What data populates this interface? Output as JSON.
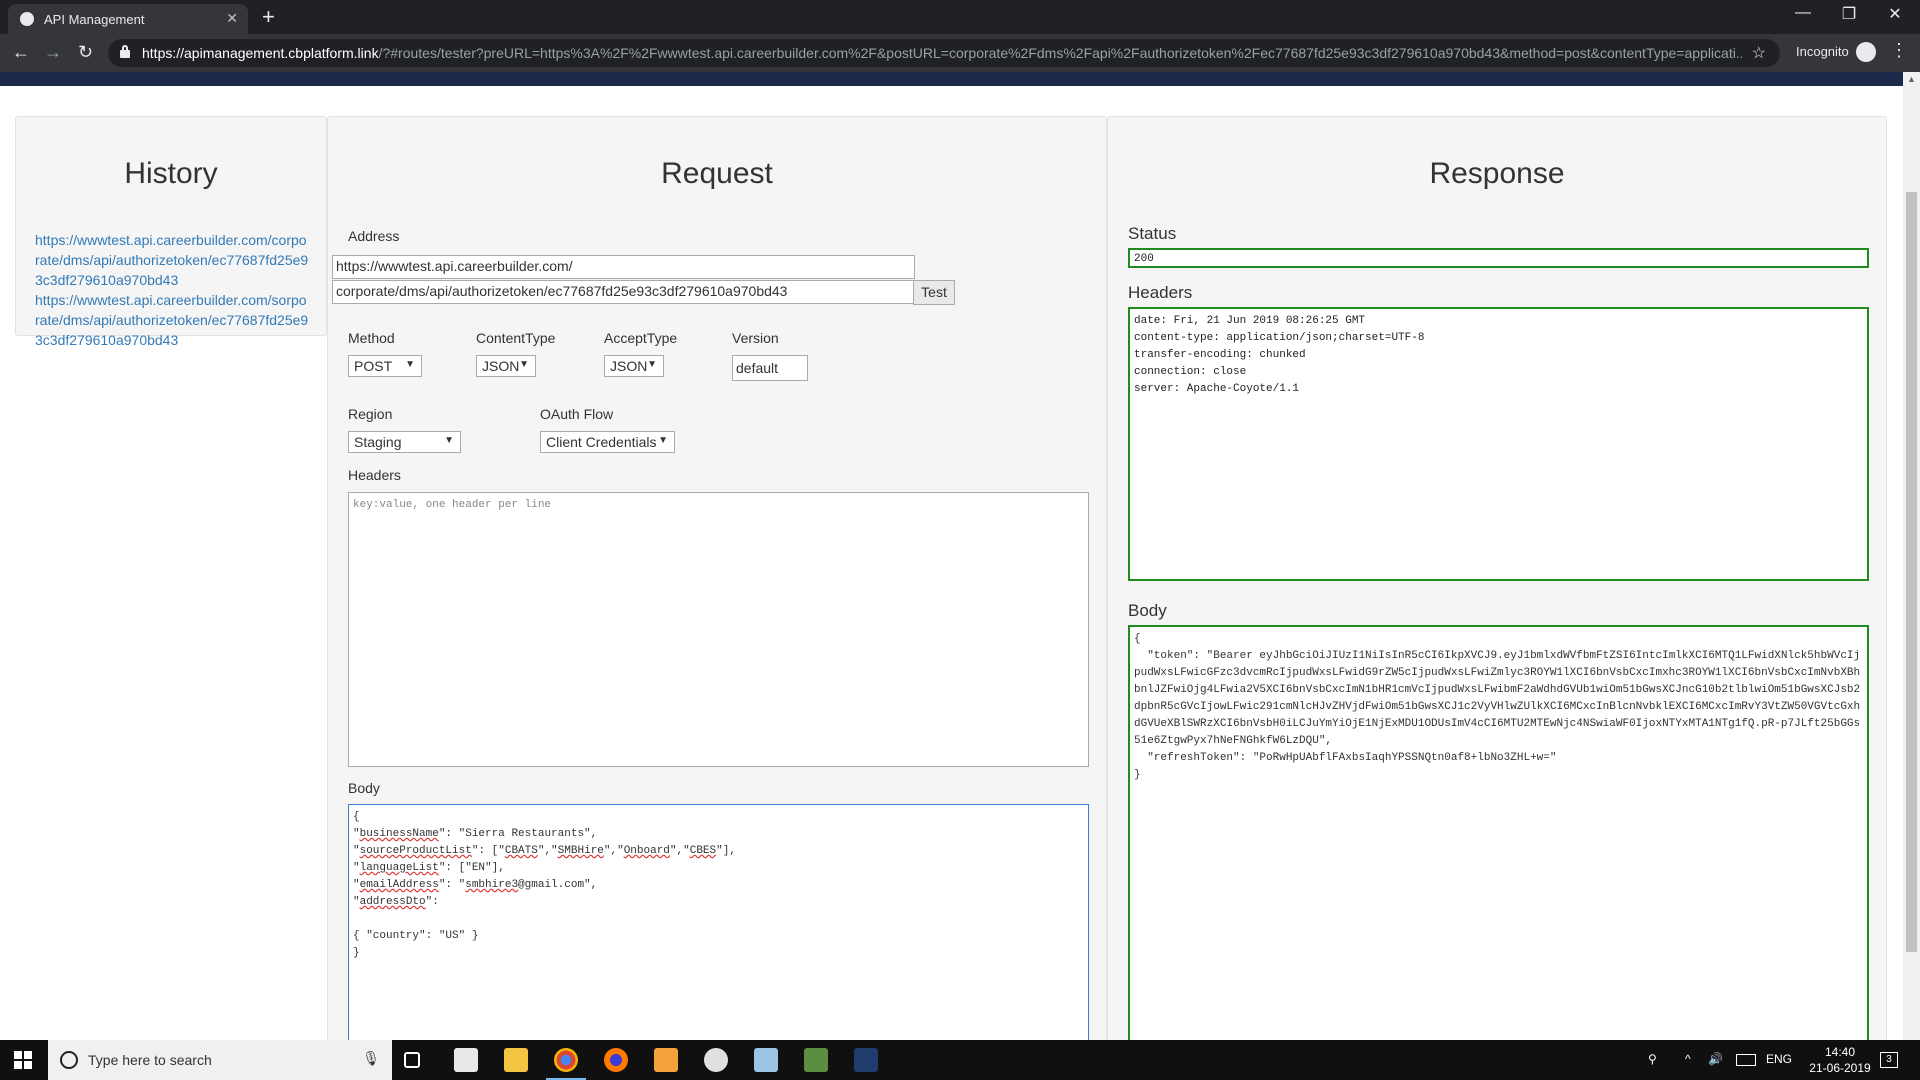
{
  "browser": {
    "tab_title": "API Management",
    "close_glyph": "✕",
    "new_tab_glyph": "+",
    "url_host": "https://apimanagement.cbplatform.link",
    "url_rest": "/?#routes/tester?preURL=https%3A%2F%2Fwwwtest.api.careerbuilder.com%2F&postURL=corporate%2Fdms%2Fapi%2Fauthorizetoken%2Fec77687fd25e93c3df279610a970bd43&method=post&contentType=applicati...",
    "incognito_label": "Incognito",
    "minimize_glyph": "—",
    "maximize_glyph": "❐",
    "window_close_glyph": "✕",
    "back_glyph": "←",
    "forward_glyph": "→",
    "reload_glyph": "↻",
    "star_glyph": "☆",
    "menu_glyph": "⋮"
  },
  "history": {
    "title": "History",
    "items": [
      "https://wwwtest.api.careerbuilder.com/corporate/dms/api/authorizetoken/ec77687fd25e93c3df279610a970bd43",
      "https://wwwtest.api.careerbuilder.com/sorporate/dms/api/authorizetoken/ec77687fd25e93c3df279610a970bd43"
    ]
  },
  "request": {
    "title": "Request",
    "address_label": "Address",
    "address_pre": "https://wwwtest.api.careerbuilder.com/",
    "address_post": "corporate/dms/api/authorizetoken/ec77687fd25e93c3df279610a970bd43",
    "test_button": "Test",
    "method_label": "Method",
    "method_value": "POST",
    "content_type_label": "ContentType",
    "content_type_value": "JSON",
    "accept_type_label": "AcceptType",
    "accept_type_value": "JSON",
    "version_label": "Version",
    "version_value": "default",
    "region_label": "Region",
    "region_value": "Staging",
    "oauth_label": "OAuth Flow",
    "oauth_value": "Client Credentials",
    "headers_label": "Headers",
    "headers_placeholder": "key:value, one header per line",
    "body_label": "Body",
    "body_lines": {
      "l1": "{",
      "l2a": "\"",
      "l2b": "businessName",
      "l2c": "\": \"Sierra Restaurants\",",
      "l3a": "\"",
      "l3b": "sourceProductList",
      "l3c": "\": [\"",
      "l3d": "CBATS",
      "l3e": "\",\"",
      "l3f": "SMBHire",
      "l3g": "\",\"",
      "l3h": "Onboard",
      "l3i": "\",\"",
      "l3j": "CBES",
      "l3k": "\"],",
      "l4a": "\"",
      "l4b": "languageList",
      "l4c": "\": [\"EN\"],",
      "l5a": "\"",
      "l5b": "emailAddress",
      "l5c": "\": \"",
      "l5d": "smbhire3",
      "l5e": "@gmail.com\",",
      "l6a": "\"",
      "l6b": "addressDto",
      "l6c": "\":",
      "l7": "",
      "l8": "{ \"country\": \"US\" }",
      "l9": "}"
    }
  },
  "response": {
    "title": "Response",
    "status_label": "Status",
    "status_value": "200",
    "headers_label": "Headers",
    "headers_text": "date: Fri, 21 Jun 2019 08:26:25 GMT\ncontent-type: application/json;charset=UTF-8\ntransfer-encoding: chunked\nconnection: close\nserver: Apache-Coyote/1.1",
    "body_label": "Body",
    "body_text": "{\n  \"token\": \"Bearer eyJhbGciOiJIUzI1NiIsInR5cCI6IkpXVCJ9.eyJ1bmlxdWVfbmFtZSI6IntcImlkXCI6MTQ1LFwidXNlck5hbWVcIjpudWxsLFwicGFzc3dvcmRcIjpudWxsLFwidG9rZW5cIjpudWxsLFwiZmlyc3ROYW1lXCI6bnVsbCxcImxhc3ROYW1lXCI6bnVsbCxcImNvbXBhbnlJZFwiOjg4LFwia2V5XCI6bnVsbCxcImN1bHR1cmVcIjpudWxsLFwibmF2aWdhdGVUb1wiOm51bGwsXCJncG10b2tlblwiOm51bGwsXCJsb2dpbnR5cGVcIjowLFwic291cmNlcHJvZHVjdFwiOm51bGwsXCJ1c2VyVHlwZUlkXCI6MCxcInBlcnNvbklEXCI6MCxcImRvY3VtZW50VGVtcGxhdGVUeXBlSWRzXCI6bnVsbH0iLCJuYmYiOjE1NjExMDU1ODUsImV4cCI6MTU2MTEwNjc4NSwiaWF0IjoxNTYxMTA1NTg1fQ.pR-p7JLft25bGGs51e6ZtgwPyx7hNeFNGhkfW6LzDQU\",\n  \"refreshToken\": \"PoRwHpUAbflFAxbsIaqhYPSSNQtn0af8+lbNo3ZHL+w=\"\n}"
  },
  "taskbar": {
    "search_placeholder": "Type here to search",
    "language": "ENG",
    "time": "14:40",
    "date": "21-06-2019",
    "notification_count": "3"
  }
}
